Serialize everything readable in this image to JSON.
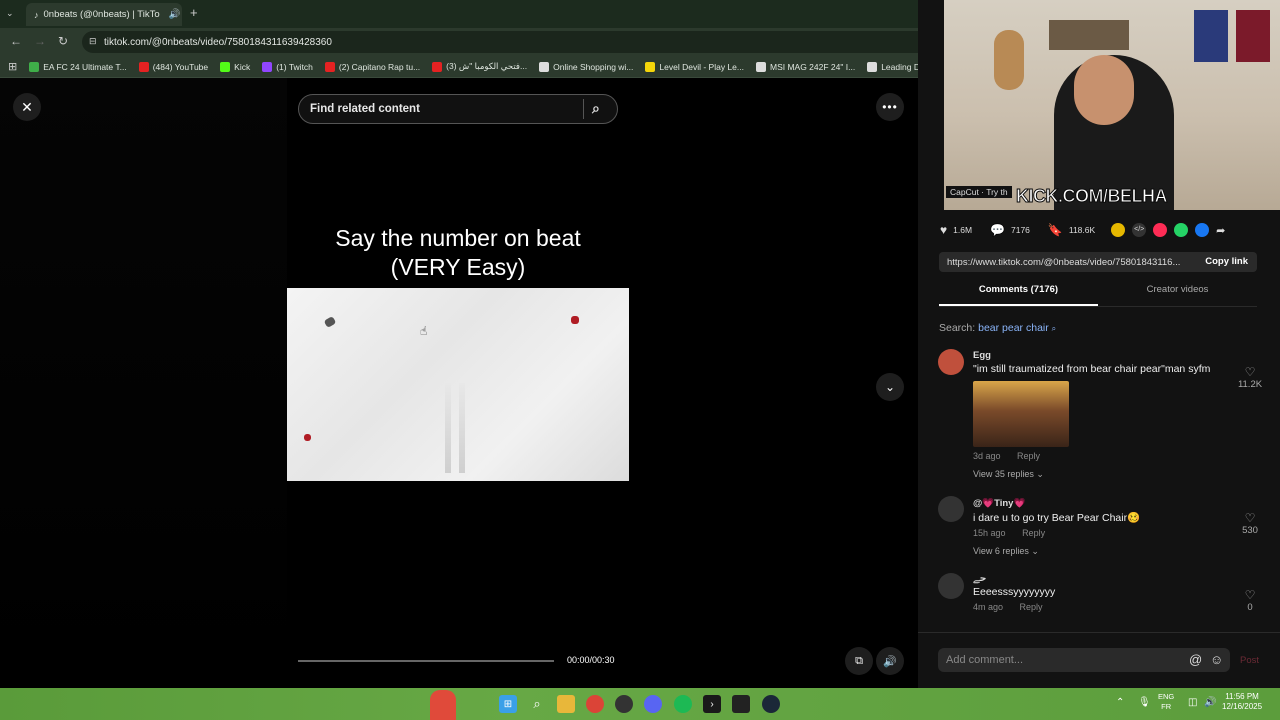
{
  "browser": {
    "tab_title": "0nbeats (@0nbeats) | TikTo",
    "url": "tiktok.com/@0nbeats/video/7580184311639428360",
    "bookmarks": [
      {
        "label": "EA FC 24 Ultimate T...",
        "color": "#3fae49"
      },
      {
        "label": "(484) YouTube",
        "color": "#e52222"
      },
      {
        "label": "Kick",
        "color": "#53fc18"
      },
      {
        "label": "(1) Twitch",
        "color": "#9146ff"
      },
      {
        "label": "(2) Capitano Rap tu...",
        "color": "#e52222"
      },
      {
        "label": "(3) فتحي الكومبا \"ش...",
        "color": "#e52222"
      },
      {
        "label": "Online Shopping wi...",
        "color": "#dddddd"
      },
      {
        "label": "Level Devil - Play Le...",
        "color": "#f5d60a"
      },
      {
        "label": "MSI MAG 242F 24\" I...",
        "color": "#dddddd"
      },
      {
        "label": "Leading Digital Stor...",
        "color": "#dddddd"
      }
    ]
  },
  "player": {
    "search_placeholder": "Find related content",
    "caption_line1": "Say the number on beat",
    "caption_line2": "(VERY Easy)",
    "time": "00:00/00:30",
    "progress": 0.0
  },
  "stream_overlay": {
    "kick_text": "KICK.COM/BELHA",
    "capcut_text": "CapCut · Try th"
  },
  "actions": {
    "likes": "1.6M",
    "comments": "7176",
    "saves": "118.6K"
  },
  "share": {
    "link": "https://www.tiktok.com/@0nbeats/video/75801843116...",
    "copy_label": "Copy link"
  },
  "tabs": {
    "comments": "Comments (7176)",
    "creator_videos": "Creator videos"
  },
  "search_hint": {
    "prefix": "Search:",
    "query": "bear pear chair"
  },
  "comments": [
    {
      "user": "Egg",
      "text": "\"im still traumatized from bear chair pear\"man syfm",
      "age": "3d ago",
      "reply": "Reply",
      "replies": "View 35 replies",
      "likes": "11.2K"
    },
    {
      "user": "@💗Tiny💗",
      "text": "i dare u to go try Bear Pear Chair🥴",
      "age": "15h ago",
      "reply": "Reply",
      "replies": "View 6 replies",
      "likes": "530"
    },
    {
      "user": "ﺣﮯ",
      "text": "Eeeesssyyyyyyyy",
      "age": "4m ago",
      "reply": "Reply",
      "likes": "0"
    }
  ],
  "composer": {
    "placeholder": "Add comment...",
    "post": "Post"
  },
  "taskbar": {
    "lang_top": "ENG",
    "lang_bottom": "FR",
    "time": "11:56 PM",
    "date": "12/16/2025"
  }
}
